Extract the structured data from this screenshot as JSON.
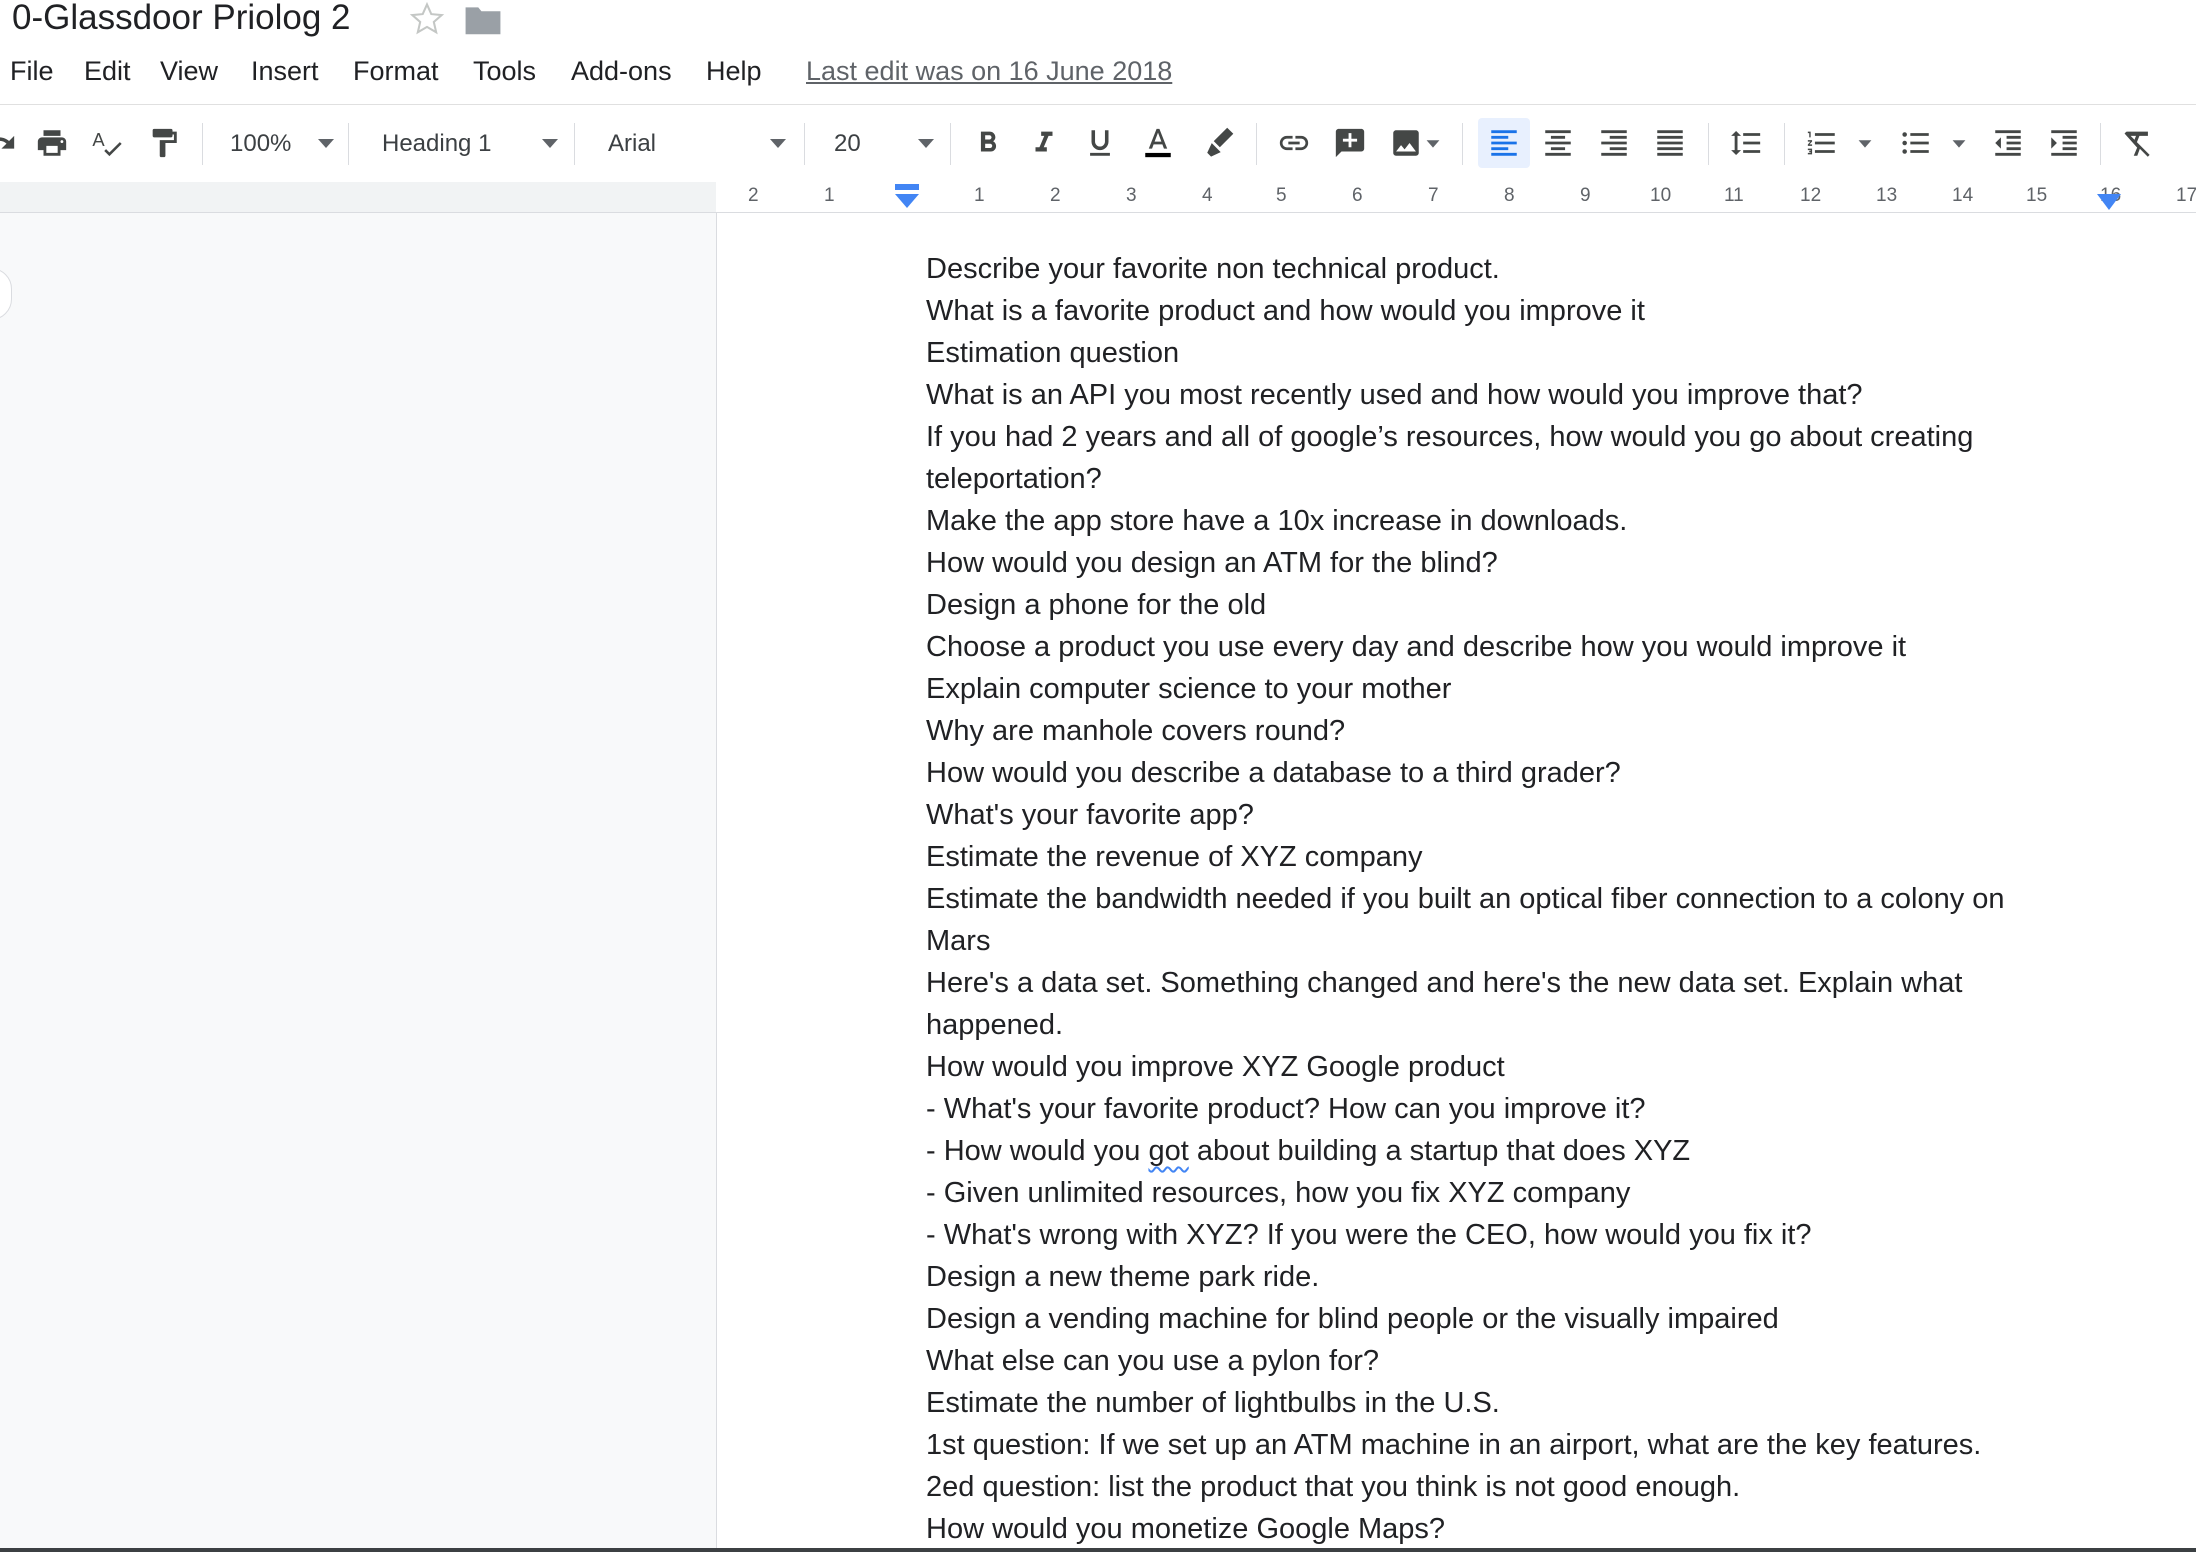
{
  "document": {
    "title": "0-Glassdoor Priolog 2"
  },
  "menu": {
    "items": [
      "File",
      "Edit",
      "View",
      "Insert",
      "Format",
      "Tools",
      "Add-ons",
      "Help"
    ],
    "last_edit": "Last edit was on 16 June 2018"
  },
  "toolbar": {
    "zoom": "100%",
    "style": "Heading 1",
    "font": "Arial",
    "font_size": "20",
    "text_color": "#000000",
    "active_alignment": "left",
    "icons": [
      "print-icon",
      "spellcheck-icon",
      "paint-format-icon",
      "bold-icon",
      "italic-icon",
      "underline-icon",
      "text-color-icon",
      "highlight-icon",
      "link-icon",
      "add-comment-icon",
      "insert-image-icon",
      "align-left-icon",
      "align-center-icon",
      "align-right-icon",
      "align-justify-icon",
      "line-spacing-icon",
      "numbered-list-icon",
      "bulleted-list-icon",
      "decrease-indent-icon",
      "increase-indent-icon",
      "clear-formatting-icon"
    ]
  },
  "ruler": {
    "labels": [
      "2",
      "1",
      "1",
      "2",
      "3",
      "4",
      "5",
      "6",
      "7",
      "8",
      "9",
      "10",
      "11",
      "12",
      "13",
      "14",
      "15",
      "16",
      "17"
    ]
  },
  "content": {
    "lines": [
      "Describe your favorite non technical product.",
      "What is a favorite product and how would you improve it",
      "Estimation question",
      "What is an API you most recently used and how would you improve that?",
      "If you had 2 years and all of google’s resources, how would you go about creating",
      "teleportation?",
      "Make the app store have a 10x increase in downloads.",
      "How would you design an ATM for the blind?",
      "Design a phone for the old",
      "Choose a product you use every day and describe how you would improve it",
      "Explain computer science to your mother",
      "Why are manhole covers round?",
      "How would you describe a database to a third grader?",
      "What's your favorite app?",
      "Estimate the revenue of XYZ company",
      "Estimate the bandwidth needed if you built an optical fiber connection to a colony on",
      "Mars",
      "Here's a data set. Something changed and here's the new data set. Explain what",
      "happened.",
      "How would you improve XYZ Google product",
      "- What's your favorite product? How can you improve it?",
      "- How would you got about building a startup that does XYZ",
      "- Given unlimited resources, how you fix XYZ company",
      "- What's wrong with XYZ? If you were the CEO, how would you fix it?",
      "Design a new theme park ride.",
      "Design a vending machine for blind people or the visually impaired",
      "What else can you use a pylon for?",
      "Estimate the number of lightbulbs in the U.S.",
      "1st question: If we set up an ATM machine in an airport, what are the key features.",
      "2ed question: list the product that you think is not good enough.",
      "How would you monetize Google Maps?"
    ],
    "misspelled_word": "got"
  }
}
